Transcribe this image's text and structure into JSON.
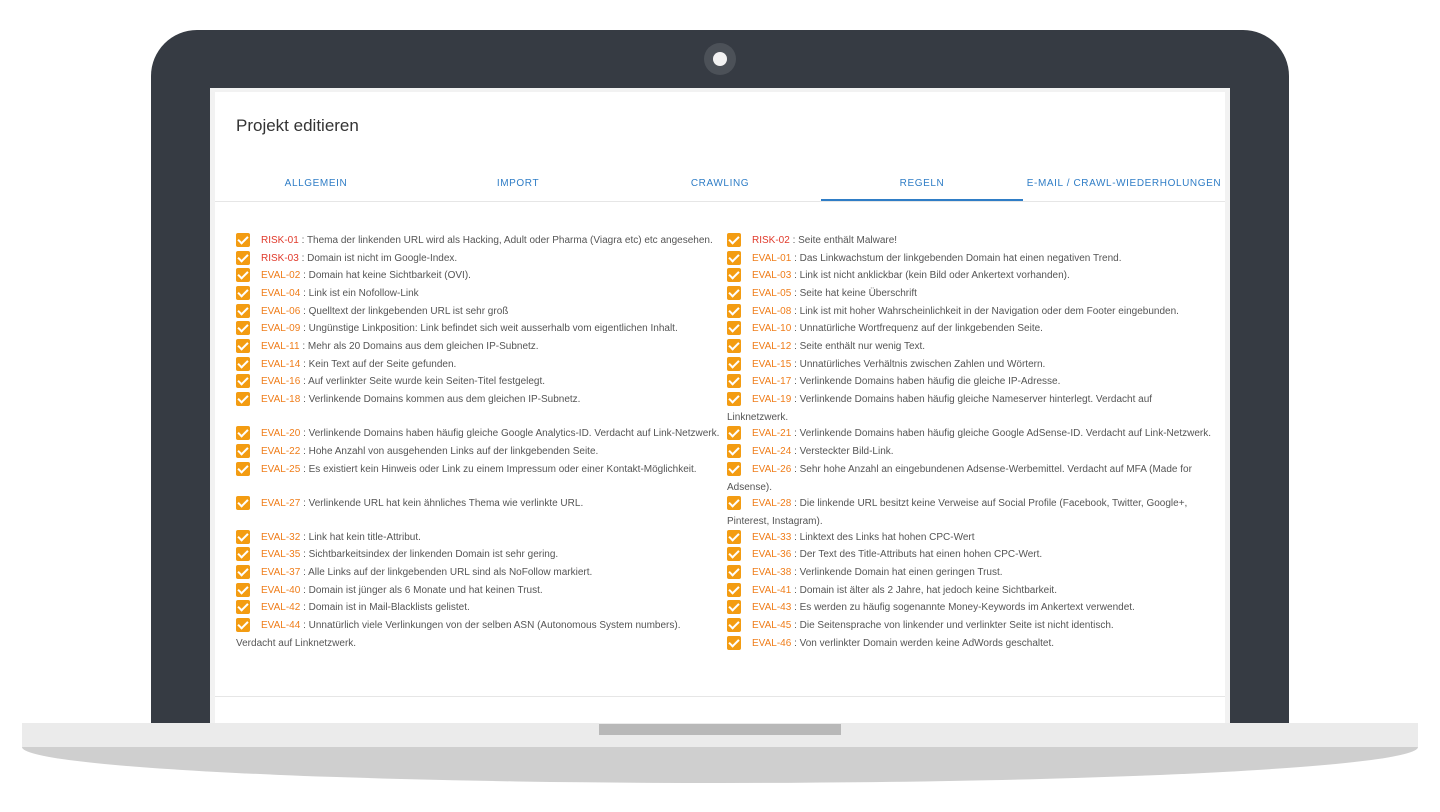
{
  "page": {
    "title": "Projekt editieren"
  },
  "tabs": [
    {
      "label": "ALLGEMEIN",
      "active": false
    },
    {
      "label": "IMPORT",
      "active": false
    },
    {
      "label": "CRAWLING",
      "active": false
    },
    {
      "label": "REGELN",
      "active": true
    },
    {
      "label": "E-MAIL / CRAWL-WIEDERHOLUNGEN",
      "active": false
    }
  ],
  "rules": {
    "left": [
      {
        "code": "RISK-01",
        "type": "risk",
        "text": " : Thema der linkenden URL wird als Hacking, Adult oder Pharma (Viagra etc) etc angesehen.",
        "checked": true
      },
      {
        "code": "RISK-03",
        "type": "risk",
        "text": " : Domain ist nicht im Google-Index.",
        "checked": true
      },
      {
        "code": "EVAL-02",
        "type": "eval",
        "text": " : Domain hat keine Sichtbarkeit (OVI).",
        "checked": true
      },
      {
        "code": "EVAL-04",
        "type": "eval",
        "text": " : Link ist ein Nofollow-Link",
        "checked": true
      },
      {
        "code": "EVAL-06",
        "type": "eval",
        "text": " : Quelltext der linkgebenden URL ist sehr groß",
        "checked": true
      },
      {
        "code": "EVAL-09",
        "type": "eval",
        "text": " : Ungünstige Linkposition: Link befindet sich weit ausserhalb vom eigentlichen Inhalt.",
        "checked": true
      },
      {
        "code": "EVAL-11",
        "type": "eval",
        "text": " : Mehr als 20 Domains aus dem gleichen IP-Subnetz.",
        "checked": true
      },
      {
        "code": "EVAL-14",
        "type": "eval",
        "text": " : Kein Text auf der Seite gefunden.",
        "checked": true
      },
      {
        "code": "EVAL-16",
        "type": "eval",
        "text": " : Auf verlinkter Seite wurde kein Seiten-Titel festgelegt.",
        "checked": true
      },
      {
        "code": "EVAL-18",
        "type": "eval",
        "text": " : Verlinkende Domains kommen aus dem gleichen IP-Subnetz.",
        "checked": true
      },
      {
        "code": "EVAL-20",
        "type": "eval",
        "text": " : Verlinkende Domains haben häufig gleiche Google Analytics-ID. Verdacht auf Link-Netzwerk.",
        "checked": true
      },
      {
        "code": "EVAL-22",
        "type": "eval",
        "text": " : Hohe Anzahl von ausgehenden Links auf der linkgebenden Seite.",
        "checked": true
      },
      {
        "code": "EVAL-25",
        "type": "eval",
        "text": " : Es existiert kein Hinweis oder Link zu einem Impressum oder einer Kontakt-Möglichkeit.",
        "checked": true
      },
      {
        "code": "EVAL-27",
        "type": "eval",
        "text": " : Verlinkende URL hat kein ähnliches Thema wie verlinkte URL.",
        "checked": true
      },
      {
        "code": "EVAL-32",
        "type": "eval",
        "text": " : Link hat kein title-Attribut.",
        "checked": true
      },
      {
        "code": "EVAL-35",
        "type": "eval",
        "text": " : Sichtbarkeitsindex der linkenden Domain ist sehr gering.",
        "checked": true
      },
      {
        "code": "EVAL-37",
        "type": "eval",
        "text": " : Alle Links auf der linkgebenden URL sind als NoFollow markiert.",
        "checked": true
      },
      {
        "code": "EVAL-40",
        "type": "eval",
        "text": " : Domain ist jünger als 6 Monate und hat keinen Trust.",
        "checked": true
      },
      {
        "code": "EVAL-42",
        "type": "eval",
        "text": " : Domain ist in Mail-Blacklists gelistet.",
        "checked": true
      },
      {
        "code": "EVAL-44",
        "type": "eval",
        "text": " : Unnatürlich viele Verlinkungen von der selben ASN (Autonomous System numbers).",
        "text2": "Verdacht auf Linknetzwerk.",
        "checked": true
      }
    ],
    "right": [
      {
        "code": "RISK-02",
        "type": "risk",
        "text": " : Seite enthält Malware!",
        "checked": true
      },
      {
        "code": "EVAL-01",
        "type": "eval",
        "text": " : Das Linkwachstum der linkgebenden Domain hat einen negativen Trend.",
        "checked": true
      },
      {
        "code": "EVAL-03",
        "type": "eval",
        "text": " : Link ist nicht anklickbar (kein Bild oder Ankertext vorhanden).",
        "checked": true
      },
      {
        "code": "EVAL-05",
        "type": "eval",
        "text": " : Seite hat keine Überschrift",
        "checked": true
      },
      {
        "code": "EVAL-08",
        "type": "eval",
        "text": " : Link ist mit hoher Wahrscheinlichkeit in der Navigation oder dem Footer eingebunden.",
        "checked": true
      },
      {
        "code": "EVAL-10",
        "type": "eval",
        "text": " : Unnatürliche Wortfrequenz auf der linkgebenden Seite.",
        "checked": true
      },
      {
        "code": "EVAL-12",
        "type": "eval",
        "text": " : Seite enthält nur wenig Text.",
        "checked": true
      },
      {
        "code": "EVAL-15",
        "type": "eval",
        "text": " : Unnatürliches Verhältnis zwischen Zahlen und Wörtern.",
        "checked": true
      },
      {
        "code": "EVAL-17",
        "type": "eval",
        "text": " : Verlinkende Domains haben häufig die gleiche IP-Adresse.",
        "checked": true
      },
      {
        "code": "EVAL-19",
        "type": "eval",
        "text": " : Verlinkende Domains haben häufig gleiche Nameserver hinterlegt. Verdacht auf",
        "text2": "Linknetzwerk.",
        "checked": true
      },
      {
        "code": "EVAL-21",
        "type": "eval",
        "text": " : Verlinkende Domains haben häufig gleiche Google AdSense-ID. Verdacht auf Link-Netzwerk.",
        "checked": true
      },
      {
        "code": "EVAL-24",
        "type": "eval",
        "text": " : Versteckter Bild-Link.",
        "checked": true
      },
      {
        "code": "EVAL-26",
        "type": "eval",
        "text": " : Sehr hohe Anzahl an eingebundenen Adsense-Werbemittel. Verdacht auf MFA (Made for",
        "text2": "Adsense).",
        "checked": true
      },
      {
        "code": "EVAL-28",
        "type": "eval",
        "text": " : Die linkende URL besitzt keine Verweise auf Social Profile (Facebook, Twitter, Google+,",
        "text2": "Pinterest, Instagram).",
        "checked": true
      },
      {
        "code": "EVAL-33",
        "type": "eval",
        "text": " : Linktext des Links hat hohen CPC-Wert",
        "checked": true
      },
      {
        "code": "EVAL-36",
        "type": "eval",
        "text": " : Der Text des Title-Attributs hat einen hohen CPC-Wert.",
        "checked": true
      },
      {
        "code": "EVAL-38",
        "type": "eval",
        "text": " : Verlinkende Domain hat einen geringen Trust.",
        "checked": true
      },
      {
        "code": "EVAL-41",
        "type": "eval",
        "text": " : Domain ist älter als 2 Jahre, hat jedoch keine Sichtbarkeit.",
        "checked": true
      },
      {
        "code": "EVAL-43",
        "type": "eval",
        "text": " : Es werden zu häufig sogenannte Money-Keywords im Ankertext verwendet.",
        "checked": true
      },
      {
        "code": "EVAL-45",
        "type": "eval",
        "text": " : Die Seitensprache von linkender und verlinkter Seite ist nicht identisch.",
        "checked": true
      },
      {
        "code": "EVAL-46",
        "type": "eval",
        "text": " : Von verlinkter Domain werden keine AdWords geschaltet.",
        "checked": true
      }
    ]
  },
  "colors": {
    "accent": "#2f7dc6",
    "checkbox": "#f39c12",
    "risk": "#e03a2b",
    "eval": "#ef7d1a",
    "bezel": "#363b43"
  }
}
